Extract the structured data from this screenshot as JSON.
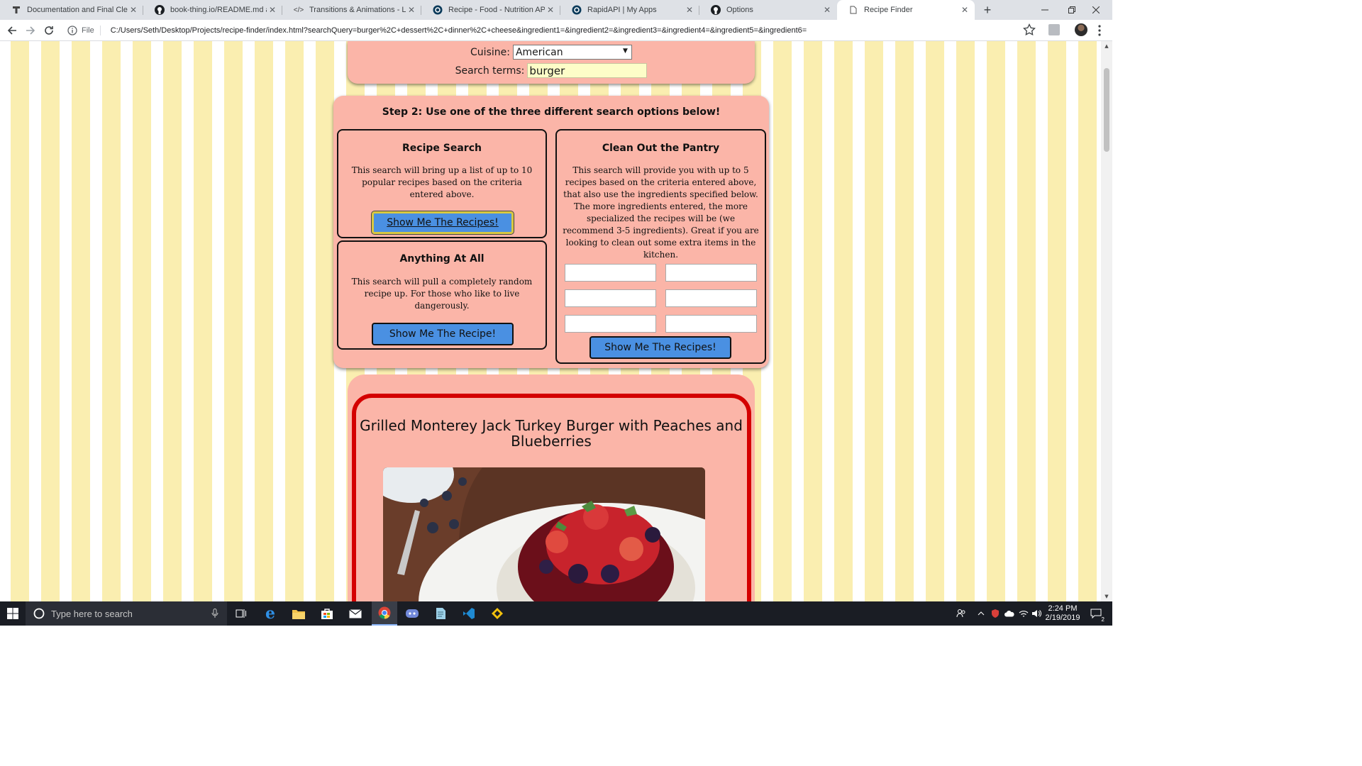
{
  "browser": {
    "tabs": [
      {
        "title": "Documentation and Final Cleanu",
        "icon": "typora-icon",
        "active": false
      },
      {
        "title": "book-thing.io/README.md at m",
        "icon": "github-icon",
        "active": false
      },
      {
        "title": "Transitions & Animations - Learn",
        "icon": "code-icon",
        "active": false
      },
      {
        "title": "Recipe - Food - Nutrition API Do",
        "icon": "rapidapi-icon",
        "active": false
      },
      {
        "title": "RapidAPI | My Apps",
        "icon": "rapidapi-icon",
        "active": false
      },
      {
        "title": "Options",
        "icon": "github-icon",
        "active": false
      },
      {
        "title": "Recipe Finder",
        "icon": "page-icon",
        "active": true
      }
    ],
    "new_tab": "+",
    "address": {
      "scheme": "File",
      "url": "C:/Users/Seth/Desktop/Projects/recipe-finder/index.html?searchQuery=burger%2C+dessert%2C+dinner%2C+cheese&ingredient1=&ingredient2=&ingredient3=&ingredient4=&ingredient5=&ingredient6="
    }
  },
  "page": {
    "step1": {
      "cuisine_label": "Cuisine:",
      "cuisine_value": "American",
      "search_label": "Search terms:",
      "search_value": "burger"
    },
    "step2": {
      "title": "Step 2: Use one of the three different search options below!",
      "recipe_search": {
        "title": "Recipe Search",
        "desc": "This search will bring up a list of up to 10 popular recipes based on the criteria entered above.",
        "button": "Show Me The Recipes!"
      },
      "anything": {
        "title": "Anything At All",
        "desc": "This search will pull a completely random recipe up. For those who like to live dangerously.",
        "button": "Show Me The Recipe!"
      },
      "pantry": {
        "title": "Clean Out the Pantry",
        "desc": "This search will provide you with up to 5 recipes based on the criteria entered above, that also use the ingredients specified below. The more ingredients entered, the more specialized the recipes will be (we recommend 3-5 ingredients). Great if you are looking to clean out some extra items in the kitchen.",
        "ingredients": [
          "",
          "",
          "",
          "",
          "",
          ""
        ],
        "button": "Show Me The Recipes!"
      }
    },
    "result": {
      "title": "Grilled Monterey Jack Turkey Burger with Peaches and Blueberries"
    }
  },
  "taskbar": {
    "search_placeholder": "Type here to search",
    "time": "2:24 PM",
    "date": "2/19/2019",
    "notification_count": "2"
  },
  "colors": {
    "stripe_yellow": "#faeeb0",
    "panel_salmon": "#fbb5a8",
    "button_blue": "#4a90e2",
    "frame_red": "#d40000",
    "search_input_bg": "#fdfdc8"
  }
}
